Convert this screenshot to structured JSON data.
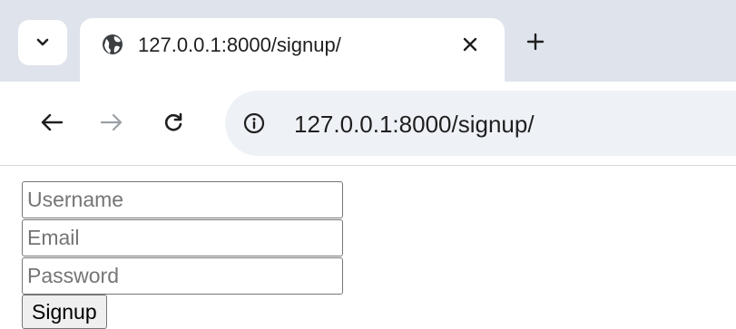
{
  "tabstrip": {
    "search_icon": "chevron-down-icon",
    "tab": {
      "title": "127.0.0.1:8000/signup/",
      "favicon": "globe-icon",
      "close_icon": "close-icon"
    },
    "new_tab_icon": "plus-icon"
  },
  "toolbar": {
    "back_icon": "arrow-left-icon",
    "forward_icon": "arrow-right-icon",
    "reload_icon": "reload-icon",
    "site_info_icon": "info-icon",
    "url": "127.0.0.1:8000/signup/"
  },
  "form": {
    "username": {
      "placeholder": "Username",
      "value": ""
    },
    "email": {
      "placeholder": "Email",
      "value": ""
    },
    "password": {
      "placeholder": "Password",
      "value": ""
    },
    "submit_label": "Signup"
  },
  "colors": {
    "tabstrip_bg": "#dfe3eb",
    "omnibox_bg": "#eef1f6",
    "text": "#1f1f1f"
  }
}
